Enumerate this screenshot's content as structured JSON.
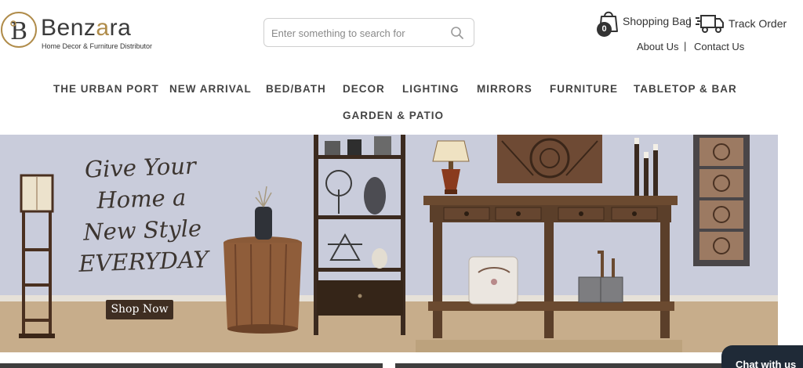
{
  "brand": {
    "name_start": "Benz",
    "name_accent": "a",
    "name_end": "ra",
    "tagline": "Home Decor & Furniture Distributor",
    "logo_monogram": "B"
  },
  "search": {
    "placeholder": "Enter something to search for",
    "icon": "search-icon"
  },
  "header": {
    "bag_count": "0",
    "bag_label": "Shopping Bag",
    "bag_icon": "shopping-bag-icon",
    "separator": "|",
    "track_label": "Track Order",
    "track_icon": "delivery-truck-icon",
    "about_label": "About Us",
    "contact_label": "Contact Us"
  },
  "nav": {
    "items": [
      "THE URBAN PORT",
      "NEW ARRIVAL",
      "BED/BATH",
      "DECOR",
      "LIGHTING",
      "MIRRORS",
      "FURNITURE",
      "TABLETOP & BAR",
      "GARDEN & PATIO"
    ]
  },
  "hero": {
    "headline": [
      "Give Your",
      "Home a",
      "New Style",
      "EVERYDAY"
    ],
    "cta": "Shop Now"
  },
  "chat": {
    "label": "Chat with us"
  },
  "colors": {
    "brand_gold": "#b08c4a",
    "text_dark": "#333333",
    "wall": "#cdd0de",
    "floor": "#c7ad8b",
    "wood": "#5b3f2a",
    "cta_bg": "#3f2e22",
    "chat_bg": "#1f2a37"
  }
}
